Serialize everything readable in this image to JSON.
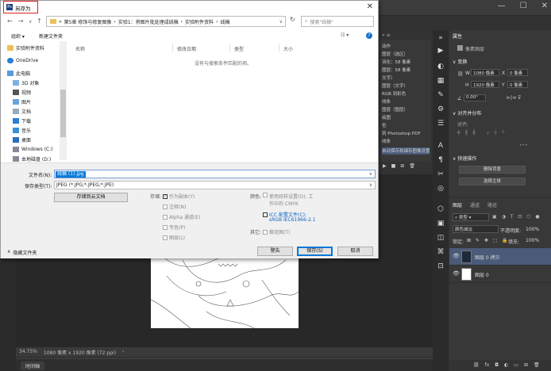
{
  "dialog": {
    "title": "另存为",
    "address_path": [
      "«",
      "第5章 修饰与修复图像",
      "›",
      "实验1：将图片批处理成线稿",
      "›",
      "实验附件资料",
      "›",
      "线稿"
    ],
    "search_placeholder": "搜索\"线稿\"",
    "organize_label": "组织 ▾",
    "new_folder_label": "新建文件夹",
    "nav_items": [
      "实验附件资料",
      "OneDrive",
      "此电脑",
      "3D 对象",
      "视频",
      "图片",
      "文档",
      "下载",
      "音乐",
      "桌面",
      "Windows (C:)",
      "本地磁盘 (D:)"
    ],
    "columns": [
      "名称",
      "修改日期",
      "类型",
      "大小"
    ],
    "empty_message": "没有与搜索条件匹配的项。",
    "filename_label": "文件名(N):",
    "filename_value": "线稿 (1).jpg",
    "filetype_label": "保存类型(T):",
    "filetype_value": "JPEG (*.JPG;*.JPEG;*.JPE)",
    "save_cloud_label": "存储到云文档",
    "storage_label": "存储:",
    "storage_options": [
      "作为副本(Y)",
      "注释(N)",
      "Alpha 通道(E)",
      "专色(P)",
      "图层(L)"
    ],
    "color_label": "颜色:",
    "proof_label": "使用校样设置(O): 工作中的 CMYK",
    "icc_label": "ICC 配置文件(C):",
    "icc_value": "sRGB IEC61966-2.1",
    "other_label": "其它:",
    "thumbnail_label": "缩览图(T)",
    "hide_folders_label": "隐藏文件夹",
    "buttons": {
      "save_as_copy": "警告",
      "save": "保存(S)",
      "cancel": "取消"
    }
  },
  "photoshop": {
    "history_items": [
      "动作",
      "图层（选区）",
      "羽化：58 像素",
      "图层：58 像素",
      "文字）",
      "图层（文字）",
      "RGB 到彩色",
      "线条",
      "图层（图层）",
      "绘图",
      "色",
      "到 Photoshop PDF",
      "线条",
      "自动保存和储存图像设置"
    ],
    "properties_title": "属性",
    "pixel_layer_label": "像素图层",
    "transform_label": "变换",
    "w_label": "W",
    "w_value": "1080 像素",
    "h_label": "H",
    "h_value": "1920 像素",
    "x_label": "X",
    "x_value": "0 像素",
    "y_label": "Y",
    "y_value": "0 像素",
    "angle_value": "0.00°",
    "align_label": "对齐并分布",
    "align_sub": "对齐:",
    "quick_actions": "快速操作",
    "remove_bg": "删除背景",
    "select_subject": "选择主体",
    "layer_tabs": [
      "图层",
      "通道",
      "路径"
    ],
    "kind_label": "类型",
    "blend_mode": "颜色减淡",
    "opacity_label": "不透明度:",
    "opacity_value": "100%",
    "lock_label": "锁定:",
    "fill_label": "填充:",
    "fill_value": "100%",
    "layers": [
      "图层 0 拷贝",
      "图层 0"
    ],
    "zoom": "34.75%",
    "doc_info": "1080 像素 x 1920 像素 (72 ppi)",
    "timeline_tab": "时间轴"
  }
}
